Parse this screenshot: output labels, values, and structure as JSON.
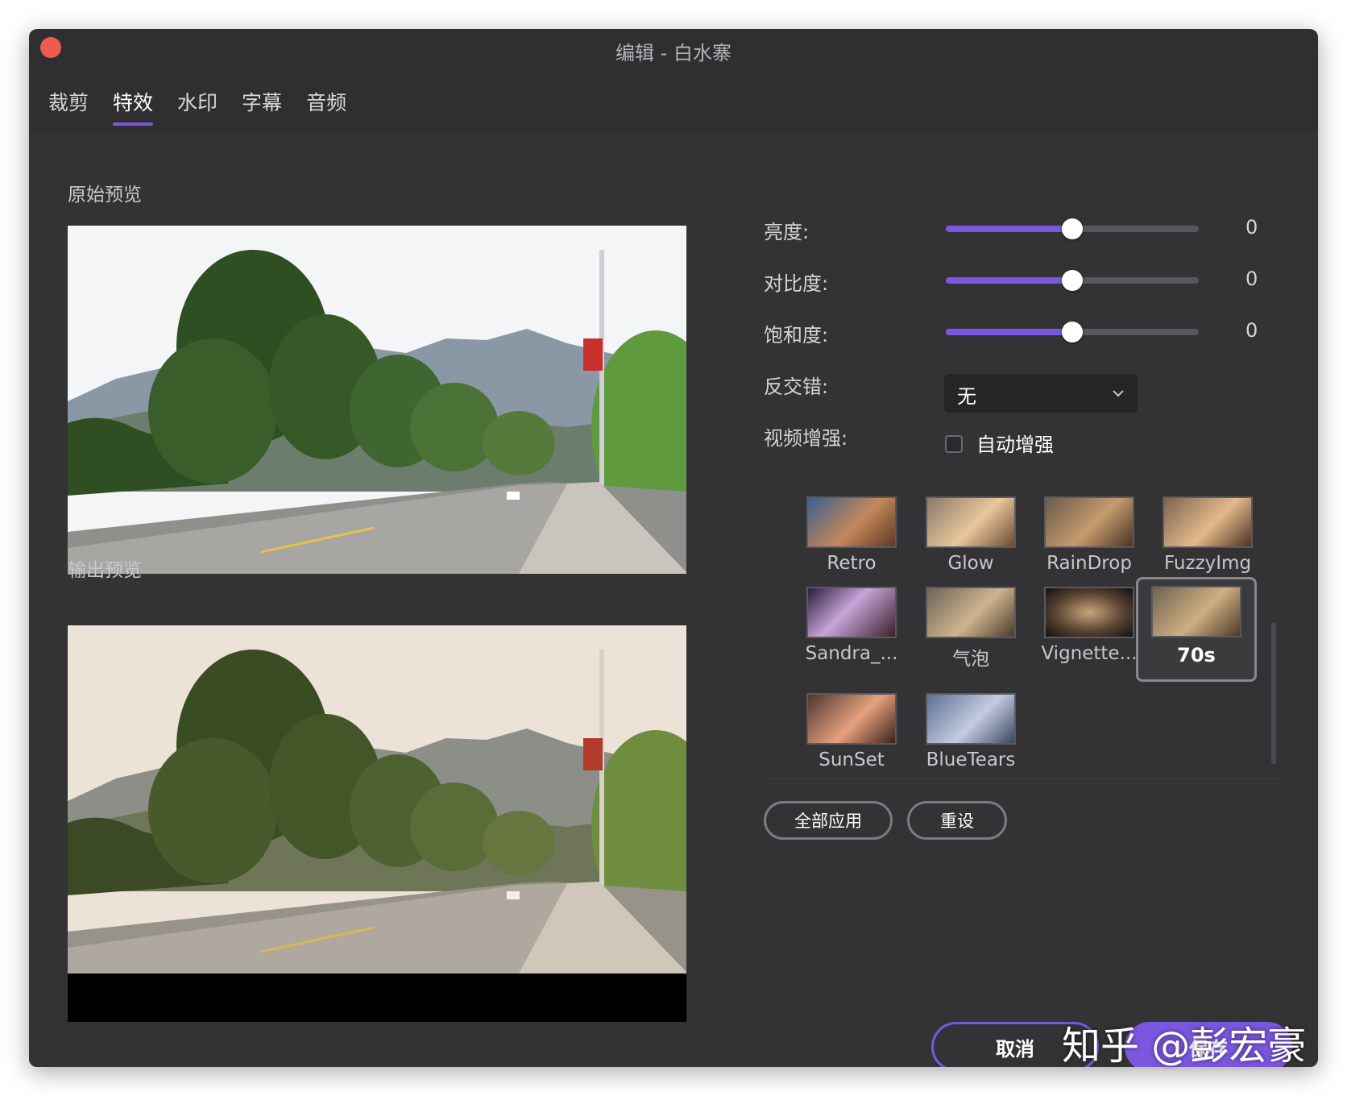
{
  "window": {
    "title": "编辑 - 白水寨"
  },
  "tabs": [
    {
      "label": "裁剪",
      "active": false
    },
    {
      "label": "特效",
      "active": true
    },
    {
      "label": "水印",
      "active": false
    },
    {
      "label": "字幕",
      "active": false
    },
    {
      "label": "音频",
      "active": false
    }
  ],
  "previews": {
    "original_label": "原始预览",
    "output_label": "输出预览"
  },
  "controls": {
    "brightness": {
      "label": "亮度:",
      "value": "0",
      "level": 0.5
    },
    "contrast": {
      "label": "对比度:",
      "value": "0",
      "level": 0.5
    },
    "saturation": {
      "label": "饱和度:",
      "value": "0",
      "level": 0.5
    },
    "deinterlace": {
      "label": "反交错:",
      "selected": "无"
    },
    "enhance": {
      "label": "视频增强:",
      "checkbox_label": "自动增强",
      "checked": false
    }
  },
  "effects": [
    {
      "name": "Retro",
      "selected": false
    },
    {
      "name": "Glow",
      "selected": false
    },
    {
      "name": "RainDrop",
      "selected": false
    },
    {
      "name": "FuzzyImg",
      "selected": false
    },
    {
      "name": "Sandra_...",
      "selected": false
    },
    {
      "name": "气泡",
      "selected": false
    },
    {
      "name": "Vignette...",
      "selected": false
    },
    {
      "name": "70s",
      "selected": true
    },
    {
      "name": "SunSet",
      "selected": false
    },
    {
      "name": "BlueTears",
      "selected": false
    }
  ],
  "actions": {
    "apply_all": "全部应用",
    "reset": "重设",
    "cancel": "取消",
    "save": "保存"
  },
  "watermark": "知乎 @彭宏豪",
  "colors": {
    "accent": "#7b57e0",
    "window_bg": "#2f2f31",
    "close_button": "#ee5b4f"
  }
}
